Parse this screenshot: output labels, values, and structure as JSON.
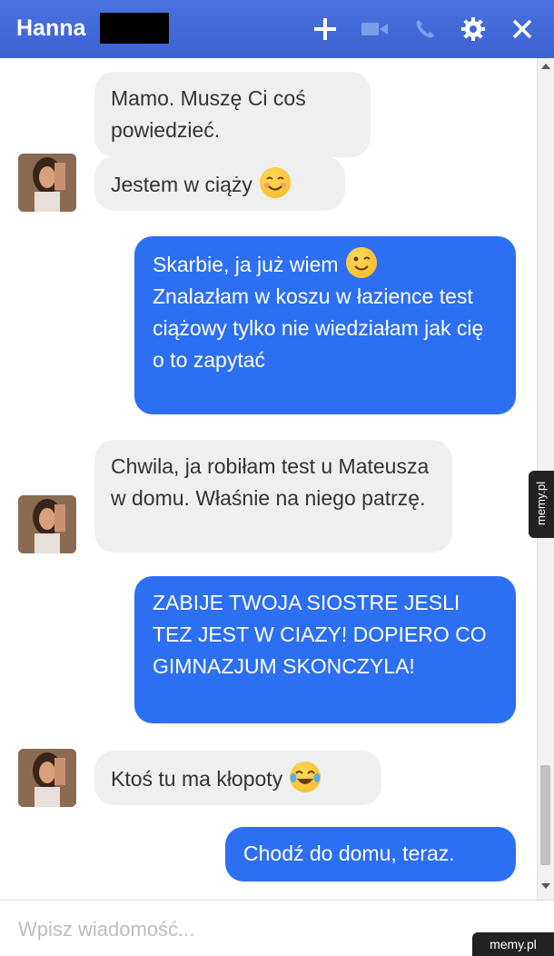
{
  "header": {
    "contact_name": "Hanna",
    "icons": [
      "plus-icon",
      "video-camera-icon",
      "phone-icon",
      "gear-icon",
      "close-icon"
    ],
    "color": "#4267d8"
  },
  "messages": [
    {
      "side": "in",
      "text": "Mamo. Muszę Ci coś powiedzieć."
    },
    {
      "side": "in",
      "text": "Jestem w ciąży",
      "emoji": "smiling-face-emoji"
    },
    {
      "side": "out",
      "text": "Skarbie, ja już wiem",
      "text2": "Znalazłam w koszu w łazience test ciążowy tylko nie wiedziałam jak cię o to zapytać",
      "emoji": "winking-face-emoji"
    },
    {
      "side": "in",
      "text": "Chwila, ja robiłam test u Mateusza w domu. Właśnie na niego patrzę."
    },
    {
      "side": "out",
      "text": "ZABIJE TWOJA SIOSTRE JESLI TEZ JEST W CIAZY! DOPIERO CO GIMNAZJUM SKONCZYLA!"
    },
    {
      "side": "in",
      "text": "Ktoś tu ma kłopoty",
      "emoji": "tears-of-joy-emoji"
    },
    {
      "side": "out",
      "text": "Chodź do domu, teraz."
    }
  ],
  "composer": {
    "placeholder": "Wpisz wiadomość..."
  },
  "watermarks": {
    "side": "memy.pl",
    "corner": "memy.pl"
  },
  "colors": {
    "outgoing": "#2d6ff2",
    "incoming": "#efefef"
  }
}
